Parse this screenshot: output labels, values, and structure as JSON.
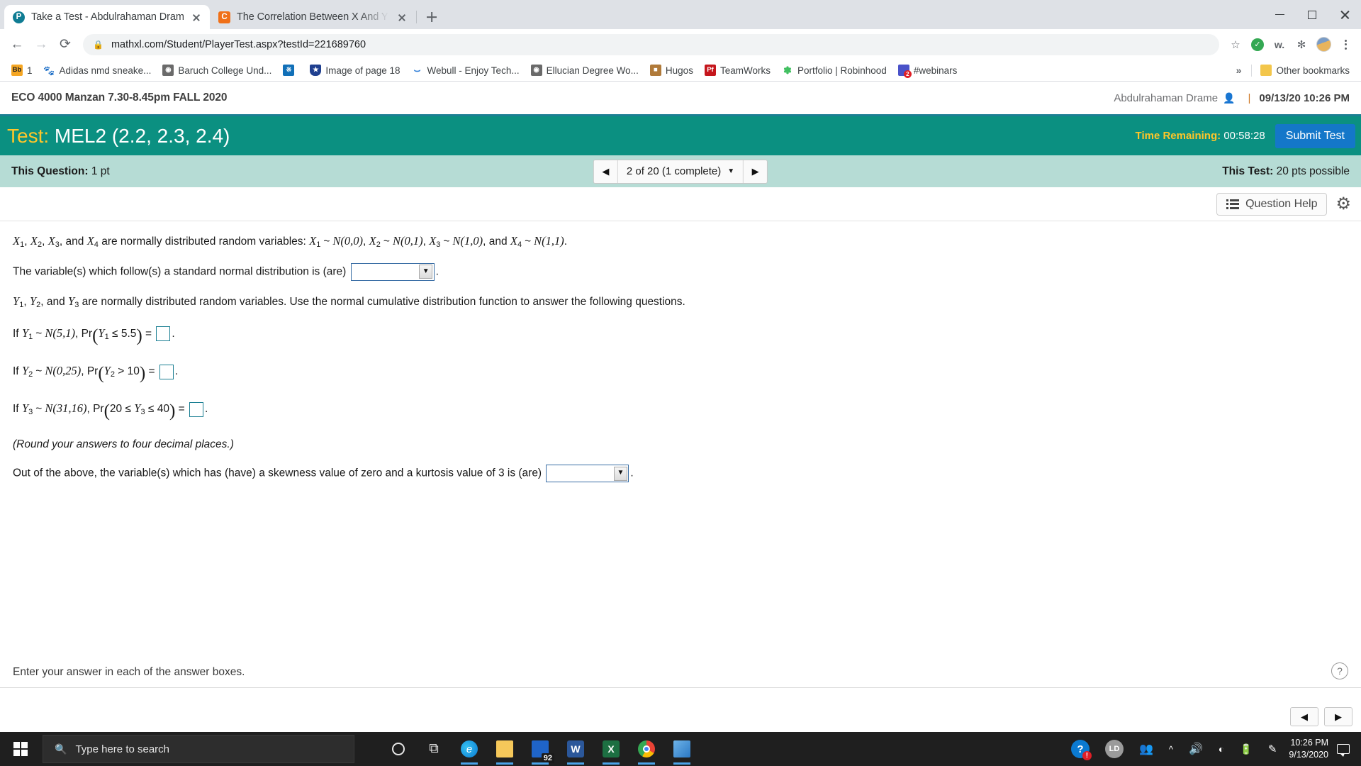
{
  "browser": {
    "tabs": [
      {
        "title": "Take a Test - Abdulrahaman Drame",
        "favicon": "P",
        "active": true
      },
      {
        "title": "The Correlation Between X And Y",
        "favicon": "C",
        "active": false
      }
    ],
    "newtab_label": "+",
    "window_controls": {
      "minimize": "minimize-button",
      "maximize": "maximize-button",
      "close": "close-button"
    },
    "nav": {
      "back": "←",
      "forward": "→",
      "reload": "⟳"
    },
    "omnibox": {
      "lock": "🔒",
      "url": "mathxl.com/Student/PlayerTest.aspx?testId=221689760"
    },
    "toolbar_right": {
      "star": "☆",
      "extension_w": "w.",
      "puzzle": "✻",
      "menu": "kebab-menu"
    },
    "bookmarks": [
      {
        "label": "1",
        "icon_text": "Bb",
        "icon_color": "#f5a623",
        "icon_fg": "#222222"
      },
      {
        "label": "Adidas nmd sneake...",
        "icon_text": "",
        "icon_color": "#1a1a1a",
        "icon_fg": "#ffffff"
      },
      {
        "label": "Baruch College Und...",
        "icon_text": "",
        "icon_color": "#555555",
        "icon_fg": "#ffffff"
      },
      {
        "label": "",
        "icon_text": "",
        "icon_color": "#1170b8",
        "icon_fg": "#ffffff"
      },
      {
        "label": "Image of page 18",
        "icon_text": "★",
        "icon_color": "#1f3f8f",
        "icon_fg": "#ffffff"
      },
      {
        "label": "Webull - Enjoy Tech...",
        "icon_text": "",
        "icon_color": "#2f7ed8",
        "icon_fg": "#ffffff"
      },
      {
        "label": "Ellucian Degree Wo...",
        "icon_text": "",
        "icon_color": "#555555",
        "icon_fg": "#ffffff"
      },
      {
        "label": "Hugos",
        "icon_text": "",
        "icon_color": "#b07a3a",
        "icon_fg": "#ffffff"
      },
      {
        "label": "TeamWorks",
        "icon_text": "Pf",
        "icon_color": "#c5161c",
        "icon_fg": "#ffffff"
      },
      {
        "label": "Portfolio | Robinhood",
        "icon_text": "",
        "icon_color": "#3fbf5f",
        "icon_fg": "#ffffff"
      },
      {
        "label": "#webinars",
        "icon_text": "",
        "icon_color": "#4a52c9",
        "icon_fg": "#ffffff"
      }
    ],
    "bookmarks_overflow": "»",
    "other_bookmarks": "Other bookmarks"
  },
  "mathxl": {
    "course_title": "ECO 4000 Manzan 7.30-8.45pm FALL 2020",
    "user_name": "Abdulrahaman Drame",
    "user_icon": "👤",
    "separator": "|",
    "datetime": "09/13/20 10:26 PM",
    "test": {
      "label": "Test:",
      "name": "MEL2 (2.2, 2.3, 2.4)",
      "time_remaining_label": "Time Remaining:",
      "time_remaining_value": "00:58:28",
      "submit_label": "Submit Test",
      "bar_color": "#0b9081",
      "accent_color": "#ffc629",
      "submit_color": "#1477c9"
    },
    "nav": {
      "this_question_label": "This Question:",
      "this_question_value": "1 pt",
      "question_position": "2 of 20 (1 complete)",
      "prev_arrow": "◀",
      "next_arrow": "▶",
      "caret": "▼",
      "this_test_label": "This Test:",
      "this_test_value": "20 pts possible",
      "bar_color": "#b6dcd5"
    },
    "question_help_label": "Question Help",
    "gear_icon": "⚙",
    "question": {
      "intro": {
        "vars": [
          "X",
          "X",
          "X",
          "X"
        ],
        "subs": [
          "1",
          "2",
          "3",
          "4"
        ],
        "text_a": ", and ",
        "text_b": " are normally distributed random variables: ",
        "dists": [
          "N(0,0)",
          "N(0,1)",
          "N(1,0)",
          "N(1,1)"
        ],
        "tail": "."
      },
      "line1_prefix": "The variable(s) which follow(s) a standard normal distribution is (are)",
      "line1_suffix": ".",
      "line2": " are normally distributed random variables. Use the normal cumulative distribution function to answer the following questions.",
      "line2_vars": [
        "Y",
        "Y",
        "Y"
      ],
      "line2_subs": [
        "1",
        "2",
        "3"
      ],
      "items": [
        {
          "prefix": "If",
          "var": "Y",
          "sub": "1",
          "dist": "N(5,1)",
          "pr_open": "Pr",
          "expr_var": "Y",
          "expr_sub": "1",
          "expr_rel": "≤ 5.5",
          "eq": "=",
          "suffix": "."
        },
        {
          "prefix": "If",
          "var": "Y",
          "sub": "2",
          "dist": "N(0,25)",
          "pr_open": "Pr",
          "expr_var": "Y",
          "expr_sub": "2",
          "expr_rel": "> 10",
          "eq": "=",
          "suffix": "."
        },
        {
          "prefix": "If",
          "var": "Y",
          "sub": "3",
          "dist": "N(31,16)",
          "pr_open": "Pr",
          "expr_pre": "20 ≤ ",
          "expr_var": "Y",
          "expr_sub": "3",
          "expr_rel": "≤ 40",
          "eq": "=",
          "suffix": "."
        }
      ],
      "round_note": "(Round your answers to four decimal places.)",
      "final_prefix": "Out of the above, the variable(s) which has (have) a skewness value of zero and a kurtosis value of 3 is (are)",
      "final_suffix": "."
    },
    "footer_note": "Enter your answer in each of the answer boxes.",
    "help_glyph": "?",
    "pager": {
      "prev": "◀",
      "next": "▶"
    }
  },
  "taskbar": {
    "start_label": "start-button",
    "search_placeholder": "Type here to search",
    "search_icon": "🔍",
    "apps": [
      {
        "name": "cortana-circle",
        "glyph": "○"
      },
      {
        "name": "task-view",
        "glyph": "⧉"
      },
      {
        "name": "edge",
        "glyph": "e"
      },
      {
        "name": "file-explorer",
        "glyph": "📁"
      },
      {
        "name": "mail",
        "glyph": "✉",
        "badge": "92"
      },
      {
        "name": "word",
        "glyph": "W"
      },
      {
        "name": "excel",
        "glyph": "X"
      },
      {
        "name": "chrome",
        "glyph": "◉"
      },
      {
        "name": "photos",
        "glyph": "🏞"
      }
    ],
    "tray": {
      "help_badge": "?",
      "help_badge_count": "!",
      "user_initials": "LD",
      "people_icon": "👥",
      "chevron_up": "⌃",
      "volume": "🔊",
      "wifi": "📶",
      "battery": "🔋",
      "pen": "✎"
    },
    "clock_time": "10:26 PM",
    "clock_date": "9/13/2020",
    "notification_icon": "notification-center-icon"
  }
}
